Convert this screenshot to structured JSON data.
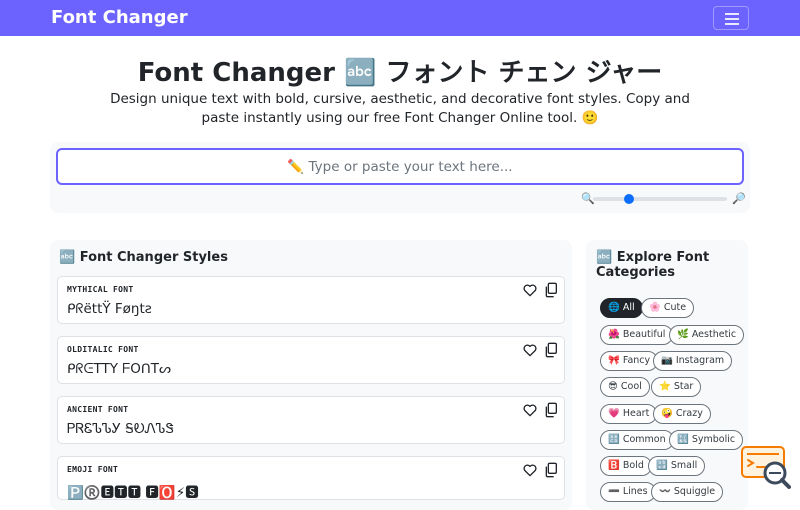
{
  "navbar": {
    "brand": "Font Changer"
  },
  "hero": {
    "title": "Font Changer 🔤 フォント チェン ジャー",
    "tagline": "Design unique text with bold, cursive, aesthetic, and decorative font styles. Copy and paste instantly using our free Font Changer Online tool. 🙂"
  },
  "input": {
    "placeholder": "✏️ Type or paste your text here...",
    "value": ""
  },
  "size_slider": {
    "small_icon": "🔍",
    "large_icon": "🔎",
    "value_fraction": 0.27
  },
  "styles_section": {
    "heading": "🔤 Font Changer Styles",
    "fonts": [
      {
        "label": "MYTHICAL FONT",
        "sample": "ᑭᖇëttŸ Føŋtƨ"
      },
      {
        "label": "OLDITALIC FONT",
        "sample": "ᑭᖇᕮTTY ᖴOᑎTᔕ"
      },
      {
        "label": "ANCIENT FONT",
        "sample": "ᏢᏒᏋᏖᏖᎩ ᎦᎧᏁᏖᏕ"
      },
      {
        "label": "EMOJI FONT",
        "sample": "🅿️®️🅴🆃🆃 🅵🅾️⚡🆂"
      }
    ]
  },
  "categories_section": {
    "heading": "🔤 Explore Font Categories",
    "chips": [
      {
        "label": "🌐 All",
        "active": true
      },
      {
        "label": "🌸 Cute",
        "active": false
      },
      {
        "label": "🌺 Beautiful",
        "active": false
      },
      {
        "label": "🌿 Aesthetic",
        "active": false
      },
      {
        "label": "🎀 Fancy",
        "active": false
      },
      {
        "label": "📷 Instagram",
        "active": false
      },
      {
        "label": "😎 Cool",
        "active": false
      },
      {
        "label": "⭐ Star",
        "active": false
      },
      {
        "label": "💗 Heart",
        "active": false
      },
      {
        "label": "🤪 Crazy",
        "active": false
      },
      {
        "label": "🔠 Common",
        "active": false
      },
      {
        "label": "🔣 Symbolic",
        "active": false
      },
      {
        "label": "🅱️ Bold",
        "active": false
      },
      {
        "label": "🔡 Small",
        "active": false
      },
      {
        "label": "➖ Lines",
        "active": false
      },
      {
        "label": "〰️ Squiggle",
        "active": false
      }
    ]
  },
  "colors": {
    "primary": "#6c63ff",
    "slider_thumb": "#0d6efd",
    "helper_badge": "#f57c00"
  }
}
